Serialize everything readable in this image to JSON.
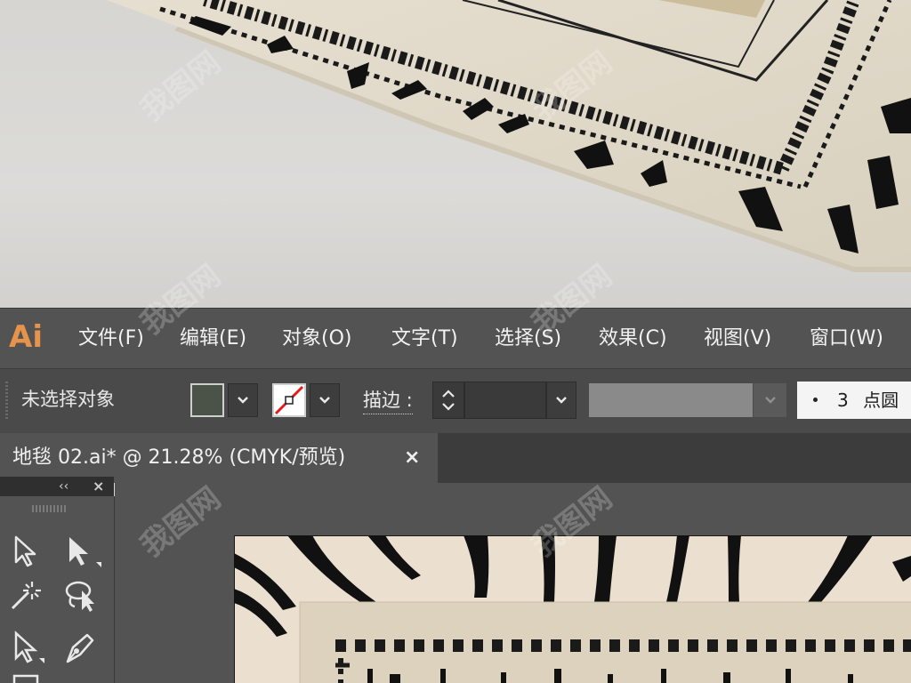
{
  "app": {
    "logo": "Ai"
  },
  "menu": [
    "文件(F)",
    "编辑(E)",
    "对象(O)",
    "文字(T)",
    "选择(S)",
    "效果(C)",
    "视图(V)",
    "窗口(W)"
  ],
  "control_bar": {
    "selection_status": "未选择对象",
    "stroke_label": "描边 :",
    "brush_dot_label": "3",
    "brush_name": "点圆"
  },
  "document_tab": {
    "title": "地毯 02.ai* @ 21.28% (CMYK/预览)",
    "close_glyph": "×"
  },
  "tools_panel": {
    "collapse_glyph": "‹‹",
    "close_glyph": "×"
  },
  "watermark": {
    "text": "我图网"
  },
  "colors": {
    "logo_orange": "#e6934b",
    "rug_beige": "#ebe0cf",
    "menu_bg": "#535353",
    "fill_swatch": "#4b5248"
  },
  "icons": {
    "selection_tool": "arrow-outline-icon",
    "direct_selection_tool": "arrow-filled-icon",
    "magic_wand_tool": "magic-wand-icon",
    "lasso_tool": "lasso-icon",
    "pen_tool": "pen-icon"
  }
}
